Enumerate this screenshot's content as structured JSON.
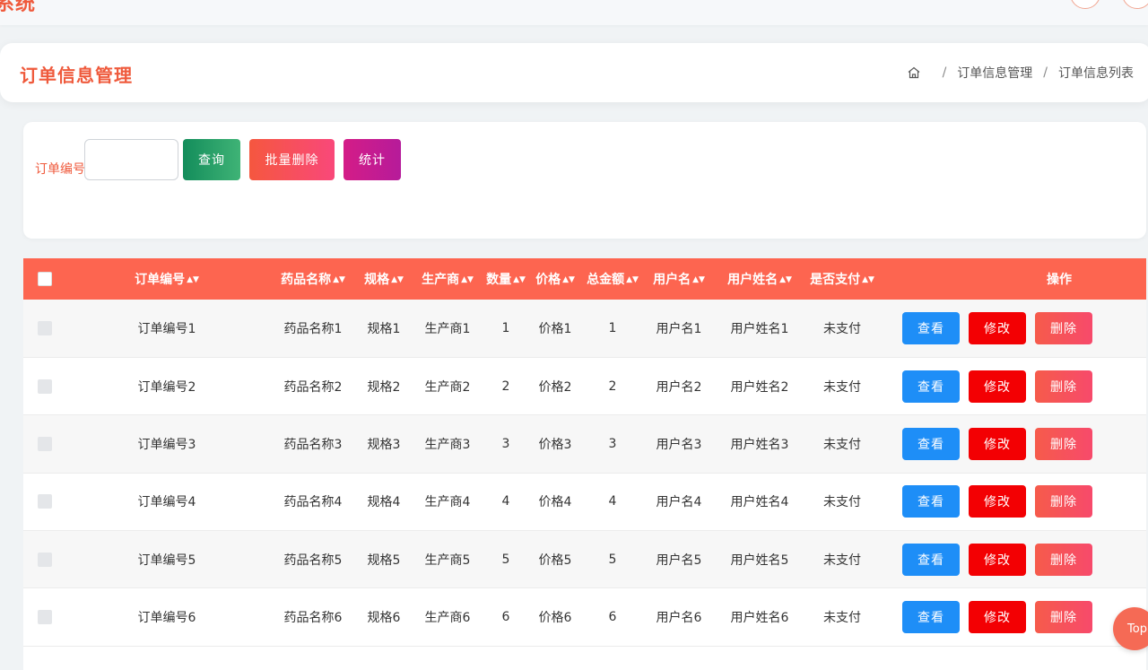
{
  "app": {
    "brand": "系统"
  },
  "header": {
    "title": "订单信息管理",
    "breadcrumb": [
      "订单信息管理",
      "订单信息列表"
    ]
  },
  "search": {
    "label": "订单编号",
    "input_value": "",
    "query_label": "查询",
    "batch_delete_label": "批量删除",
    "stats_label": "统计"
  },
  "table": {
    "columns": [
      "订单编号",
      "药品名称",
      "规格",
      "生产商",
      "数量",
      "价格",
      "总金额",
      "用户名",
      "用户姓名",
      "是否支付",
      "操作"
    ],
    "rows": [
      {
        "order_no": "订单编号1",
        "drug": "药品名称1",
        "spec": "规格1",
        "maker": "生产商1",
        "qty": "1",
        "price": "价格1",
        "total": "1",
        "username": "用户名1",
        "realname": "用户姓名1",
        "paid": "未支付"
      },
      {
        "order_no": "订单编号2",
        "drug": "药品名称2",
        "spec": "规格2",
        "maker": "生产商2",
        "qty": "2",
        "price": "价格2",
        "total": "2",
        "username": "用户名2",
        "realname": "用户姓名2",
        "paid": "未支付"
      },
      {
        "order_no": "订单编号3",
        "drug": "药品名称3",
        "spec": "规格3",
        "maker": "生产商3",
        "qty": "3",
        "price": "价格3",
        "total": "3",
        "username": "用户名3",
        "realname": "用户姓名3",
        "paid": "未支付"
      },
      {
        "order_no": "订单编号4",
        "drug": "药品名称4",
        "spec": "规格4",
        "maker": "生产商4",
        "qty": "4",
        "price": "价格4",
        "total": "4",
        "username": "用户名4",
        "realname": "用户姓名4",
        "paid": "未支付"
      },
      {
        "order_no": "订单编号5",
        "drug": "药品名称5",
        "spec": "规格5",
        "maker": "生产商5",
        "qty": "5",
        "price": "价格5",
        "total": "5",
        "username": "用户名5",
        "realname": "用户姓名5",
        "paid": "未支付"
      },
      {
        "order_no": "订单编号6",
        "drug": "药品名称6",
        "spec": "规格6",
        "maker": "生产商6",
        "qty": "6",
        "price": "价格6",
        "total": "6",
        "username": "用户名6",
        "realname": "用户姓名6",
        "paid": "未支付"
      }
    ],
    "actions": {
      "view": "查看",
      "edit": "修改",
      "delete": "删除"
    }
  },
  "back_to_top": "Top",
  "colors": {
    "accent": "#ef5a3c",
    "header_row": "#fd6550",
    "query_button": "#138d5b",
    "stats_button": "#c41b91",
    "view_button": "#1e8ef7",
    "edit_button": "#f30003",
    "delete_button": "#f65b4b"
  }
}
